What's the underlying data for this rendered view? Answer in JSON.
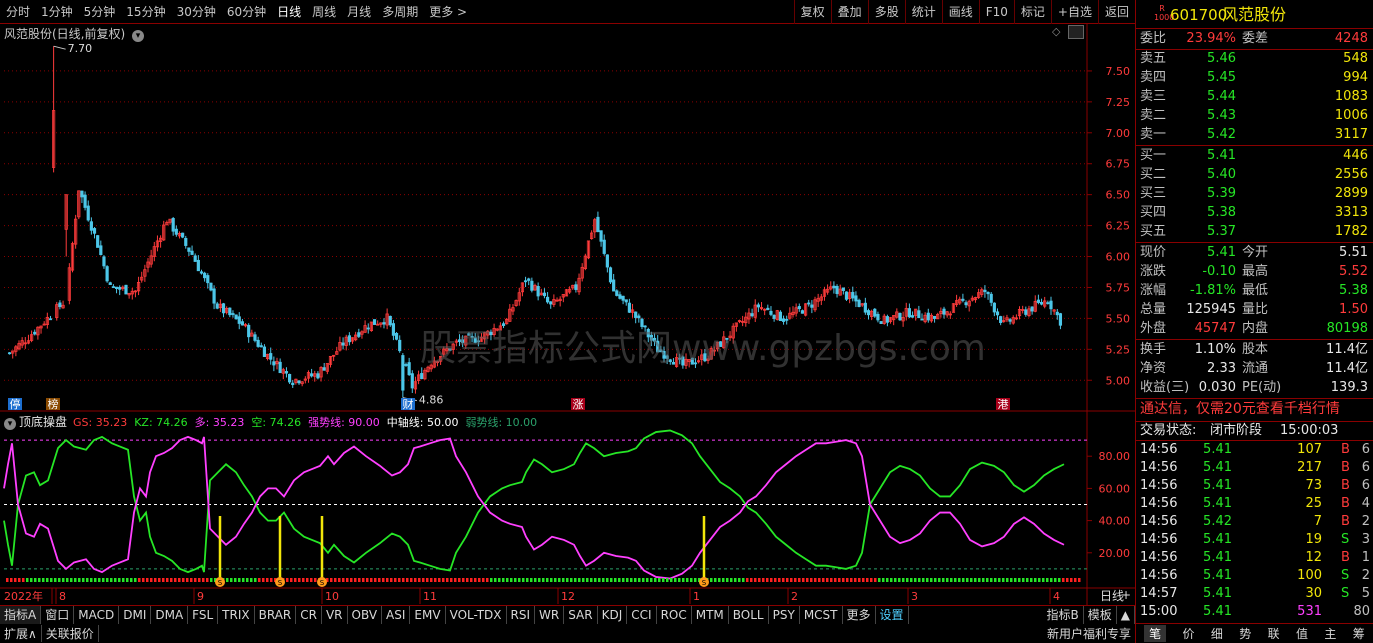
{
  "toolbar": {
    "periods": [
      "分时",
      "1分钟",
      "5分钟",
      "15分钟",
      "30分钟",
      "60分钟",
      "日线",
      "周线",
      "月线",
      "多周期",
      "更多 >"
    ],
    "active": "日线",
    "tools": [
      "复权",
      "叠加",
      "多股",
      "统计",
      "画线",
      "F10",
      "标记",
      "+自选",
      "返回"
    ]
  },
  "main_chart": {
    "title": "风范股份(日线,前复权)",
    "high_marker": "7.70",
    "low_marker": "4.86",
    "y_ticks": [
      "7.50",
      "7.25",
      "7.00",
      "6.75",
      "6.50",
      "6.25",
      "6.00",
      "5.75",
      "5.50",
      "5.25",
      "5.00"
    ],
    "tags": [
      "停",
      "榜",
      "财",
      "涨",
      "港"
    ],
    "watermark": "股票指标公式网www.gpzbgs.com"
  },
  "indicator": {
    "name": "顶底操盘",
    "values": [
      {
        "label": "GS: 35.23",
        "color": "#ff3b3b"
      },
      {
        "label": "KZ: 74.26",
        "color": "#26e626"
      },
      {
        "label": "多: 35.23",
        "color": "#ff40ff"
      },
      {
        "label": "空: 74.26",
        "color": "#26e626"
      },
      {
        "label": "强势线: 90.00",
        "color": "#ff40ff"
      },
      {
        "label": "中轴线: 50.00",
        "color": "#ffffff"
      },
      {
        "label": "弱势线: 10.00",
        "color": "#2aa06a"
      }
    ],
    "y_ticks": [
      "80.00",
      "60.00",
      "40.00",
      "20.00"
    ],
    "signal_label": "S"
  },
  "x_axis": {
    "labels": [
      "2022年",
      "8",
      "9",
      "10",
      "11",
      "12",
      "1",
      "2",
      "3",
      "4"
    ],
    "period_tag": "日线",
    "nav": [
      "-",
      "+"
    ]
  },
  "bottom_tabs": [
    "指标A",
    "窗口",
    "MACD",
    "DMI",
    "DMA",
    "FSL",
    "TRIX",
    "BRAR",
    "CR",
    "VR",
    "OBV",
    "ASI",
    "EMV",
    "VOL-TDX",
    "RSI",
    "WR",
    "SAR",
    "KDJ",
    "CCI",
    "ROC",
    "MTM",
    "BOLL",
    "PSY",
    "MCST",
    "更多",
    "设置"
  ],
  "bottom_right": [
    "指标B",
    "模板",
    "▲"
  ],
  "bottom_tabs2": [
    "扩展∧",
    "关联报价"
  ],
  "bottom_promo": "新用户福利专享",
  "quote": {
    "badge": "R 1000",
    "code": "601700",
    "name": "风范股份",
    "weibi_label": "委比",
    "weibi": "23.94%",
    "weicha_label": "委差",
    "weicha": "4248",
    "asks": [
      {
        "label": "卖五",
        "price": "5.46",
        "vol": "548"
      },
      {
        "label": "卖四",
        "price": "5.45",
        "vol": "994"
      },
      {
        "label": "卖三",
        "price": "5.44",
        "vol": "1083"
      },
      {
        "label": "卖二",
        "price": "5.43",
        "vol": "1006"
      },
      {
        "label": "卖一",
        "price": "5.42",
        "vol": "3117"
      }
    ],
    "bids": [
      {
        "label": "买一",
        "price": "5.41",
        "vol": "446"
      },
      {
        "label": "买二",
        "price": "5.40",
        "vol": "2556"
      },
      {
        "label": "买三",
        "price": "5.39",
        "vol": "2899"
      },
      {
        "label": "买四",
        "price": "5.38",
        "vol": "3313"
      },
      {
        "label": "买五",
        "price": "5.37",
        "vol": "1782"
      }
    ],
    "stats": [
      {
        "l1": "现价",
        "v1": "5.41",
        "c1": "grn",
        "l2": "今开",
        "v2": "5.51",
        "c2": "wht"
      },
      {
        "l1": "涨跌",
        "v1": "-0.10",
        "c1": "grn",
        "l2": "最高",
        "v2": "5.52",
        "c2": "red"
      },
      {
        "l1": "涨幅",
        "v1": "-1.81%",
        "c1": "grn",
        "l2": "最低",
        "v2": "5.38",
        "c2": "grn"
      },
      {
        "l1": "总量",
        "v1": "125945",
        "c1": "wht",
        "l2": "量比",
        "v2": "1.50",
        "c2": "red"
      },
      {
        "l1": "外盘",
        "v1": "45747",
        "c1": "red",
        "l2": "内盘",
        "v2": "80198",
        "c2": "grn"
      }
    ],
    "stats2": [
      {
        "l1": "换手",
        "v1": "1.10%",
        "l2": "股本",
        "v2": "11.4亿"
      },
      {
        "l1": "净资",
        "v1": "2.33",
        "l2": "流通",
        "v2": "11.4亿"
      },
      {
        "l1": "收益(三)",
        "v1": "0.030",
        "l2": "PE(动)",
        "v2": "139.3"
      }
    ],
    "ad": "通达信，仅需20元查看千档行情",
    "status_label": "交易状态:",
    "status": "闭市阶段",
    "status_time": "15:00:03",
    "trades": [
      {
        "t": "14:56",
        "p": "5.41",
        "v": "107",
        "bs": "B",
        "n": "6"
      },
      {
        "t": "14:56",
        "p": "5.41",
        "v": "217",
        "bs": "B",
        "n": "6"
      },
      {
        "t": "14:56",
        "p": "5.41",
        "v": "73",
        "bs": "B",
        "n": "6"
      },
      {
        "t": "14:56",
        "p": "5.41",
        "v": "25",
        "bs": "B",
        "n": "4"
      },
      {
        "t": "14:56",
        "p": "5.42",
        "v": "7",
        "bs": "B",
        "n": "2"
      },
      {
        "t": "14:56",
        "p": "5.41",
        "v": "19",
        "bs": "S",
        "n": "3"
      },
      {
        "t": "14:56",
        "p": "5.41",
        "v": "12",
        "bs": "B",
        "n": "1"
      },
      {
        "t": "14:56",
        "p": "5.41",
        "v": "100",
        "bs": "S",
        "n": "2"
      },
      {
        "t": "14:57",
        "p": "5.41",
        "v": "30",
        "bs": "S",
        "n": "5"
      },
      {
        "t": "15:00",
        "p": "5.41",
        "v": "531",
        "bs": "",
        "n": "80"
      }
    ],
    "tabs": [
      "笔",
      "价",
      "细",
      "势",
      "联",
      "值",
      "主",
      "筹"
    ]
  },
  "colors": {
    "up": "#ff3b3b",
    "down": "#4cc6e8",
    "ma": "#ffffff",
    "grid": "#8a0000",
    "kz": "#26e626",
    "gs": "#ff40ff",
    "signal": "#f2e60a"
  }
}
